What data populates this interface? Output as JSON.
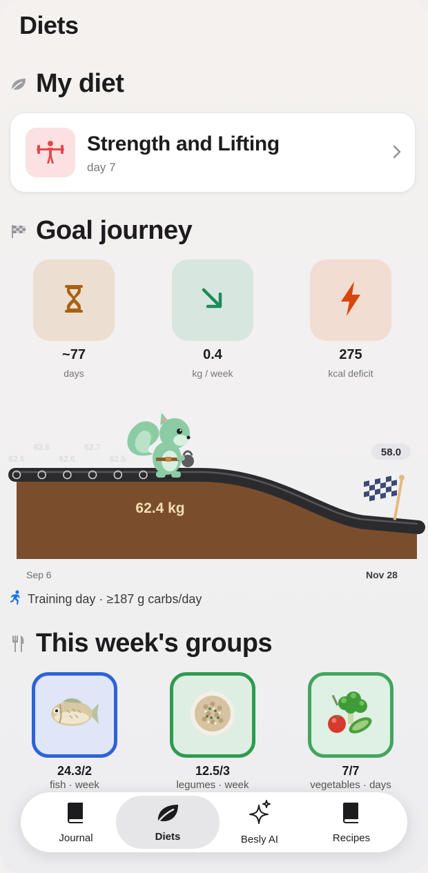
{
  "page": {
    "title": "Diets"
  },
  "my_diet": {
    "section_title": "My diet",
    "icon": "leaf-icon",
    "card": {
      "name": "Strength and Lifting",
      "day": "day 7",
      "icon": "weightlifter-icon",
      "accent": "#e5484d"
    }
  },
  "goal_journey": {
    "section_title": "Goal journey",
    "icon": "checkered-flag-icon",
    "stats": [
      {
        "value": "~77",
        "unit": "days",
        "icon": "hourglass-icon",
        "bg": "#ecdfd1",
        "color": "#a8620f"
      },
      {
        "value": "0.4",
        "unit": "kg / week",
        "icon": "arrow-down-right-icon",
        "bg": "#d7e7df",
        "color": "#1e8a5a"
      },
      {
        "value": "275",
        "unit": "kcal deficit",
        "icon": "lightning-icon",
        "bg": "#f2ddd3",
        "color": "#d6470f"
      }
    ]
  },
  "chart_data": {
    "type": "area",
    "title": "",
    "x_start_label": "Sep 6",
    "x_end_label": "Nov 28",
    "current_label": "62.4 kg",
    "current_value": 62.4,
    "goal_label": "58.0",
    "goal_value": 58.0,
    "history_labels": [
      "62.6",
      "62.6",
      "62.6",
      "62.7",
      "62.5"
    ],
    "history_values": [
      62.6,
      62.6,
      62.6,
      62.7,
      62.5
    ],
    "colors": {
      "ground": "#7a4e2d",
      "track": "#2b2b2e",
      "goal_badge": "#e5e5ea"
    }
  },
  "training": {
    "text": "Training day · ≥187 g carbs/day",
    "icon": "runner-icon",
    "color": "#1a73e8"
  },
  "groups": {
    "section_title": "This week's groups",
    "icon": "fork-knife-icon",
    "items": [
      {
        "value": "24.3/2",
        "unit": "fish · week",
        "icon": "fish-icon",
        "border": "#2d63d8",
        "bg": "#dfe6f7"
      },
      {
        "value": "12.5/3",
        "unit": "legumes · week",
        "icon": "legumes-bowl-icon",
        "border": "#2e9b4f",
        "bg": "#deeee2"
      },
      {
        "value": "7/7",
        "unit": "vegetables · days",
        "icon": "vegetables-icon",
        "border": "#43a55f",
        "bg": "#dff0e4"
      }
    ]
  },
  "tabs": [
    {
      "label": "Journal",
      "icon": "book-icon",
      "active": false
    },
    {
      "label": "Diets",
      "icon": "leaf-icon",
      "active": true
    },
    {
      "label": "Besly AI",
      "icon": "sparkles-icon",
      "active": false
    },
    {
      "label": "Recipes",
      "icon": "book-icon",
      "active": false
    }
  ]
}
